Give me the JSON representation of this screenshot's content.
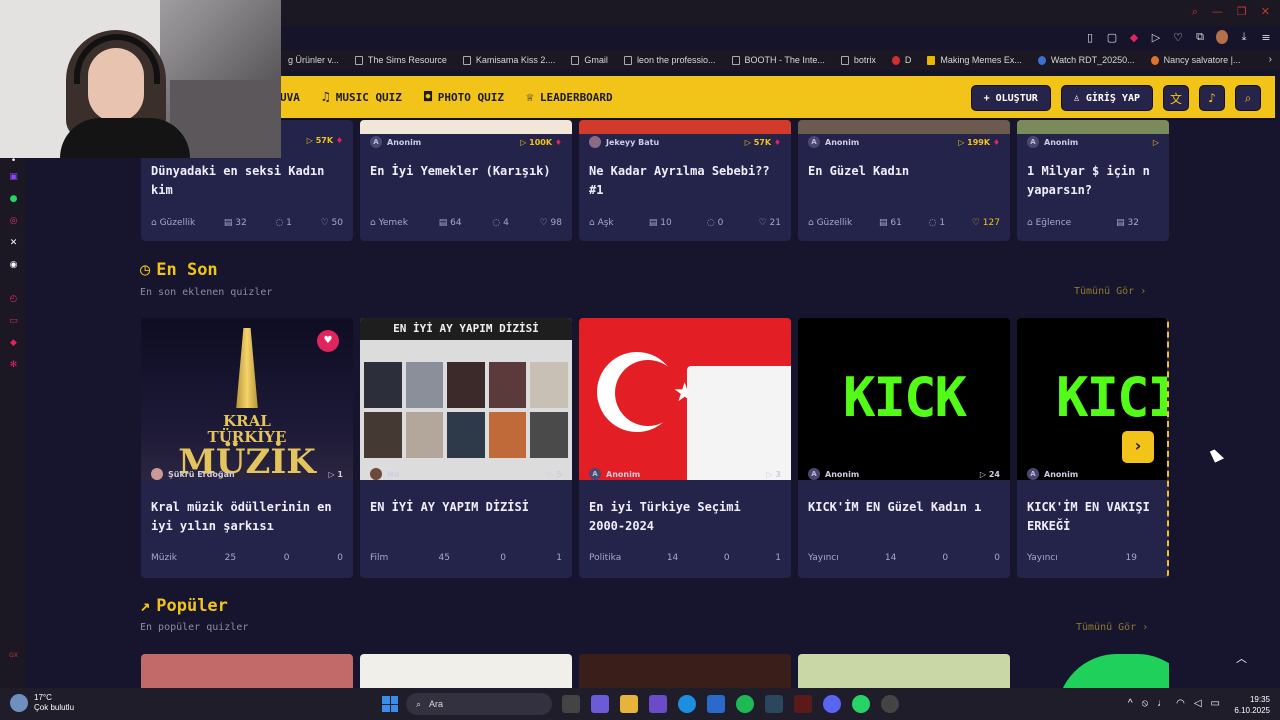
{
  "bookmarks": [
    {
      "label": "g Ürünler v...",
      "icon": "page"
    },
    {
      "label": "The Sims Resource",
      "icon": "page"
    },
    {
      "label": "Kamisama Kiss 2....",
      "icon": "page"
    },
    {
      "label": "Gmail",
      "icon": "page"
    },
    {
      "label": "leon the professio...",
      "icon": "page"
    },
    {
      "label": "BOOTH - The Inte...",
      "icon": "page"
    },
    {
      "label": "botrix",
      "icon": "page"
    },
    {
      "label": "D",
      "icon": "red"
    },
    {
      "label": "Making Memes Ex...",
      "icon": "yellow"
    },
    {
      "label": "Watch RDT_20250...",
      "icon": "blue"
    },
    {
      "label": "Nancy salvatore |...",
      "icon": "orange"
    }
  ],
  "nav": {
    "item1": "UVA",
    "item2": "MUSIC QUIZ",
    "item3": "PHOTO QUIZ",
    "item4": "LEADERBOARD",
    "create": "OLUŞTUR",
    "login": "GİRİŞ YAP"
  },
  "top_cards": [
    {
      "author": "",
      "plays": "57K",
      "title": "Dünyadaki en seksi Kadın kim",
      "category": "Güzellik",
      "questions": "32",
      "comments": "1",
      "likes": "50"
    },
    {
      "author": "Anonim",
      "plays": "100K",
      "title": "En İyi Yemekler (Karışık)",
      "category": "Yemek",
      "questions": "64",
      "comments": "4",
      "likes": "98"
    },
    {
      "author": "Jekeyy Batu",
      "plays": "57K",
      "title": "Ne Kadar Ayrılma Sebebi?? #1",
      "category": "Aşk",
      "questions": "10",
      "comments": "0",
      "likes": "21"
    },
    {
      "author": "Anonim",
      "plays": "199K",
      "title": "En Güzel Kadın",
      "category": "Güzellik",
      "questions": "61",
      "comments": "1",
      "likes": "127"
    },
    {
      "author": "Anonim",
      "plays": "",
      "title": "1 Milyar $ için n yaparsın?",
      "category": "Eğlence",
      "questions": "32",
      "comments": "",
      "likes": ""
    }
  ],
  "section_new": {
    "title": "En Son",
    "subtitle": "En son eklenen quizler",
    "see_all": "Tümünü Gör ›"
  },
  "new_cards": [
    {
      "author": "Şükrü Erdoğan",
      "plays": "1",
      "title": "Kral müzik ödüllerinin en iyi yılın şarkısı",
      "category": "Müzik",
      "questions": "25",
      "comments": "0",
      "likes": "0",
      "thumb_line1": "KRAL",
      "thumb_line2": "TÜRKİYE",
      "thumb_line3": "MÜZİK"
    },
    {
      "author": "Ha",
      "plays": "5",
      "title": "EN İYİ AY YAPIM DİZİSİ",
      "category": "Film",
      "questions": "45",
      "comments": "0",
      "likes": "1",
      "thumb_line1": "EN İYİ AY YAPIM DİZİSİ"
    },
    {
      "author": "Anonim",
      "plays": "3",
      "title": "En iyi Türkiye Seçimi 2000-2024",
      "category": "Politika",
      "questions": "14",
      "comments": "0",
      "likes": "1"
    },
    {
      "author": "Anonim",
      "plays": "24",
      "title": "KICK'İM EN Güzel Kadın ı",
      "category": "Yayıncı",
      "questions": "14",
      "comments": "0",
      "likes": "0",
      "thumb_line1": "KICK"
    },
    {
      "author": "Anonim",
      "plays": "",
      "title": "KICK'İM EN VAKIŞI ERKEĞİ",
      "category": "Yayıncı",
      "questions": "19",
      "comments": "",
      "likes": "",
      "thumb_line1": "KICI"
    }
  ],
  "section_popular": {
    "title": "Popüler",
    "subtitle": "En popüler quizler",
    "see_all": "Tümünü Gör ›"
  },
  "taskbar": {
    "temp": "17°C",
    "weather": "Çok bulutlu",
    "search": "Ara",
    "time": "19:35",
    "date": "6.10.2025"
  },
  "colors": {
    "brand_yellow": "#f2c319",
    "card_bg": "#24234a",
    "page_bg": "#16152d"
  }
}
